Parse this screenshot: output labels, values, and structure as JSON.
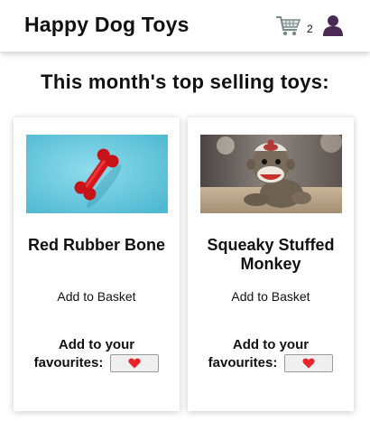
{
  "header": {
    "brand": "Happy Dog Toys",
    "cart_count": "2",
    "cart_icon": "shopping-cart-icon",
    "user_icon": "user-icon"
  },
  "main": {
    "heading": "This month's top selling toys:",
    "products": [
      {
        "name": "Red Rubber Bone",
        "image": "red-rubber-bone-photo",
        "basket_label": "Add to Basket",
        "fav_line1": "Add to your",
        "fav_line2": "favourites:"
      },
      {
        "name": "Squeaky Stuffed Monkey",
        "image": "stuffed-monkey-photo",
        "basket_label": "Add to Basket",
        "fav_line1": "Add to your",
        "fav_line2": "favourites:"
      }
    ]
  },
  "colors": {
    "heart": "#e8232b",
    "bone": "#d8151a",
    "bone_bg": "#5cc3d8",
    "user_icon": "#4a2a52",
    "cart_icon": "#7a8a8c"
  }
}
